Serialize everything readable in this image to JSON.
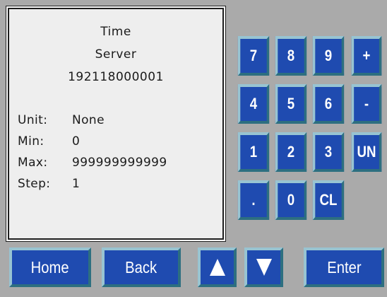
{
  "info": {
    "title_line1": "Time",
    "title_line2": "Server",
    "title_line3": "192118000001",
    "unit_label": "Unit:",
    "unit_value": "None",
    "min_label": "Min:",
    "min_value": "0",
    "max_label": "Max:",
    "max_value": "999999999999",
    "step_label": "Step:",
    "step_value": "1"
  },
  "keypad": {
    "k7": "7",
    "k8": "8",
    "k9": "9",
    "plus": "+",
    "k4": "4",
    "k5": "5",
    "k6": "6",
    "minus": "-",
    "k1": "1",
    "k2": "2",
    "k3": "3",
    "un": "UN",
    "dot": ".",
    "k0": "0",
    "cl": "CL"
  },
  "nav": {
    "home": "Home",
    "back": "Back",
    "up_icon": "arrow-up-icon",
    "down_icon": "arrow-down-icon",
    "enter": "Enter"
  },
  "colors": {
    "background": "#aaaaaa",
    "button_face": "#1f4bb0",
    "button_highlight": "#98c4d2",
    "button_shadow": "#2d6f80",
    "panel_face": "#eeeeee"
  }
}
